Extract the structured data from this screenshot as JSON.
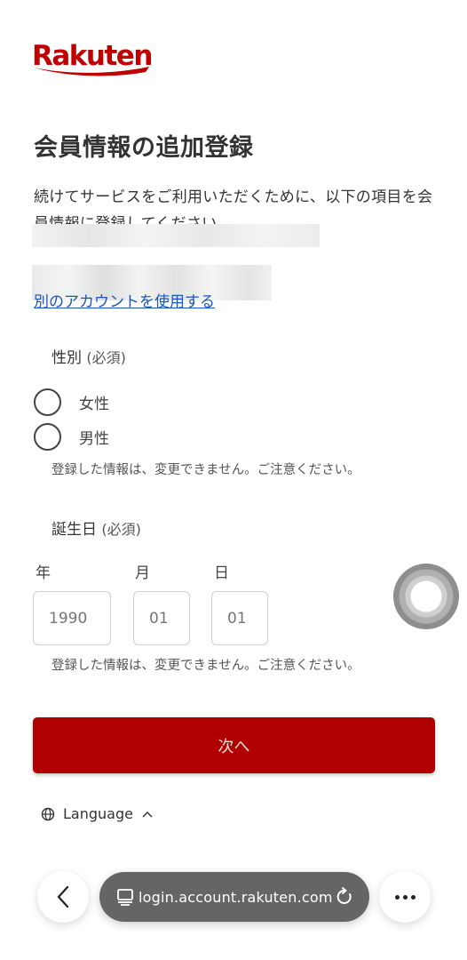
{
  "brand": {
    "logo_text": "Rakuten",
    "color": "#bf0000"
  },
  "page": {
    "title": "会員情報の追加登録",
    "intro": "続けてサービスをご利用いただくために、以下の項目を会員情報に登録してください",
    "switch_account_link": "別のアカウントを使用する"
  },
  "gender": {
    "label": "性別",
    "required": "(必須)",
    "options": [
      "女性",
      "男性"
    ],
    "note": "登録した情報は、変更できません。ご注意ください。"
  },
  "birthday": {
    "label": "誕生日",
    "required": "(必須)",
    "year_label": "年",
    "month_label": "月",
    "day_label": "日",
    "year_placeholder": "1990",
    "month_placeholder": "01",
    "day_placeholder": "01",
    "note": "登録した情報は、変更できません。ご注意ください。"
  },
  "next_button": {
    "label": "次へ",
    "color": "#b10000"
  },
  "language": {
    "label": "Language"
  },
  "browser": {
    "url": "login.account.rakuten.com"
  }
}
